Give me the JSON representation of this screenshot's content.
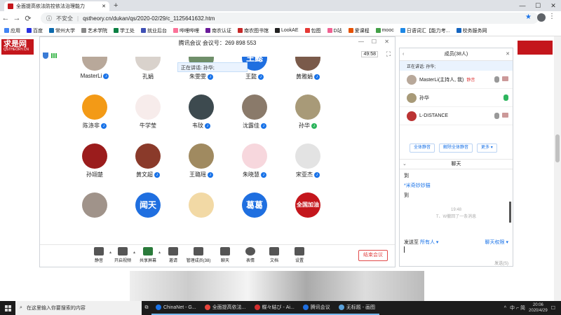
{
  "browser": {
    "tab_title": "全面提高依法防控依法治理能力",
    "new_tab": "+",
    "insecure": "不安全",
    "url": "qstheory.cn/dukan/qs/2020-02/29/c_1125641632.htm",
    "min": "—",
    "max": "☐",
    "close": "✕",
    "bookmarks": [
      {
        "label": "应用",
        "color": "#4285f4"
      },
      {
        "label": "百度",
        "color": "#2932e1"
      },
      {
        "label": "常州大学",
        "color": "#0d6aad"
      },
      {
        "label": "艺术学院",
        "color": "#888888"
      },
      {
        "label": "学工处",
        "color": "#0b8043"
      },
      {
        "label": "就业后台",
        "color": "#3f51b5"
      },
      {
        "label": "哔哩哔哩",
        "color": "#fb7299"
      },
      {
        "label": "南农认证",
        "color": "#6a1b9a"
      },
      {
        "label": "南农图书馆",
        "color": "#c62828"
      },
      {
        "label": "LookAE",
        "color": "#222222"
      },
      {
        "label": "包图",
        "color": "#e53935"
      },
      {
        "label": "D站",
        "color": "#f06292"
      },
      {
        "label": "爱课程",
        "color": "#e65100"
      },
      {
        "label": "mooc",
        "color": "#43a047"
      },
      {
        "label": "日语词汇【能力考...",
        "color": "#1e88e5"
      },
      {
        "label": "校务服务网",
        "color": "#1565c0"
      }
    ]
  },
  "site": {
    "logo": "求是网",
    "logo_sub": "QSTHEORY.CN"
  },
  "meeting": {
    "title": "腾讯会议 会议号：269 898 553",
    "timer": "49:58",
    "speaking": "正在讲话: 孙华;",
    "participants": [
      {
        "name": "MasterLi",
        "color": "#b8a89a",
        "text": "",
        "mic": "blue"
      },
      {
        "name": "孔娟",
        "color": "#d9d2cc",
        "text": "",
        "mic": "none"
      },
      {
        "name": "朱雯雯",
        "color": "#6f8f6a",
        "text": "",
        "mic": "blue"
      },
      {
        "name": "王懿",
        "color": "#1f6fe0",
        "text": "王懿",
        "mic": "blue"
      },
      {
        "name": "黄雅娟",
        "color": "#7a5a4a",
        "text": "",
        "mic": "blue"
      },
      {
        "name": "陈涤非",
        "color": "#f39a16",
        "text": "",
        "mic": "blue"
      },
      {
        "name": "牛学莹",
        "color": "#f7eceb",
        "text": "",
        "mic": "none"
      },
      {
        "name": "韦玟",
        "color": "#3d4a4f",
        "text": "",
        "mic": "blue"
      },
      {
        "name": "沈露佳",
        "color": "#8a7a6a",
        "text": "",
        "mic": "blue"
      },
      {
        "name": "孙华",
        "color": "#a89a78",
        "text": "",
        "mic": "green"
      },
      {
        "name": "孙翊楚",
        "color": "#9b1c1c",
        "text": "",
        "mic": "none"
      },
      {
        "name": "黄文超",
        "color": "#8a3a2a",
        "text": "",
        "mic": "blue"
      },
      {
        "name": "王璐瑶",
        "color": "#a08a60",
        "text": "",
        "mic": "blue"
      },
      {
        "name": "朱晓慧",
        "color": "#f7d7dd",
        "text": "",
        "mic": "blue"
      },
      {
        "name": "宋亚杰",
        "color": "#e3e3e3",
        "text": "",
        "mic": "blue"
      },
      {
        "name": "",
        "color": "#a0938a",
        "text": "",
        "mic": "none"
      },
      {
        "name": "",
        "color": "#1f6fe0",
        "text": "闻天",
        "mic": "none"
      },
      {
        "name": "",
        "color": "#f2d9a5",
        "text": "",
        "mic": "none"
      },
      {
        "name": "",
        "color": "#1f6fe0",
        "text": "葛葛",
        "mic": "none"
      },
      {
        "name": "",
        "color": "#c4161c",
        "text": "全国加油",
        "mic": "none"
      }
    ],
    "toolbar": {
      "mute": "静音",
      "video": "开启视频",
      "share": "共享屏幕",
      "invite": "邀请",
      "members": "管理成员(38)",
      "chat": "聊天",
      "emoji": "表情",
      "docs": "文档",
      "settings": "设置",
      "end": "结束会议"
    }
  },
  "panel": {
    "members_title": "成员(38人)",
    "speaking": "正在讲话: 孙华;",
    "members": [
      {
        "name": "MasterLi(主持人, 我)",
        "tag": "静音",
        "color": "#b8a89a"
      },
      {
        "name": "孙华",
        "tag": "",
        "color": "#a89a78"
      },
      {
        "name": "L-DISTANCE",
        "tag": "",
        "color": "#b33"
      }
    ],
    "btn_mute_all": "全体静音",
    "btn_unmute_all": "解除全体静音",
    "btn_more": "更多 ▾",
    "chat_title": "聊天",
    "messages": [
      {
        "kind": "text",
        "text": "到"
      },
      {
        "kind": "sender",
        "text": "*米奇妙妙猫"
      },
      {
        "kind": "text",
        "text": "到"
      },
      {
        "kind": "sys",
        "text": "19:48"
      },
      {
        "kind": "sys",
        "text": "T、W撤回了一条消息"
      }
    ],
    "send_to_label": "发送至",
    "send_to_value": "所有人 ▾",
    "chat_perm": "聊天权限 ▾",
    "send_btn": "发送(S)"
  },
  "taskbar": {
    "search": "在这里输入你要搜索的内容",
    "tasks": [
      {
        "label": "ChinaNet - G...",
        "color": "#1a73e8"
      },
      {
        "label": "全面提高依法...",
        "color": "#e8453c"
      },
      {
        "label": "蝶々結び - Ai...",
        "color": "#d32f2f"
      },
      {
        "label": "腾讯会议",
        "color": "#1f6fe0"
      },
      {
        "label": "无标题 - 画图",
        "color": "#5aa0d8"
      }
    ],
    "ime": "中 ⌐ 简",
    "time": "20:06",
    "date": "2020/4/29"
  }
}
